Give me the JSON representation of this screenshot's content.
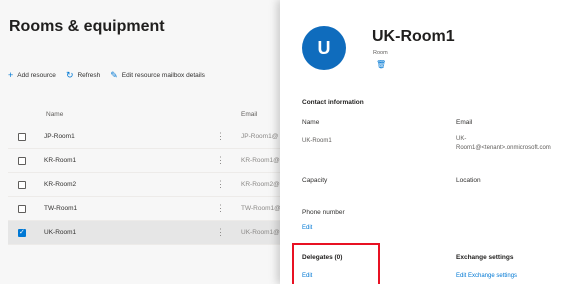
{
  "page": {
    "title": "Rooms & equipment"
  },
  "toolbar": {
    "add": "Add resource",
    "refresh": "Refresh",
    "edit_mailbox": "Edit resource mailbox details"
  },
  "list": {
    "columns": {
      "name": "Name",
      "email": "Email"
    },
    "rows": [
      {
        "name": "JP-Room1",
        "email": "JP-Room1@",
        "selected": false
      },
      {
        "name": "KR-Room1",
        "email": "KR-Room1@",
        "selected": false
      },
      {
        "name": "KR-Room2",
        "email": "KR-Room2@",
        "selected": false
      },
      {
        "name": "TW-Room1",
        "email": "TW-Room1@",
        "selected": false
      },
      {
        "name": "UK-Room1",
        "email": "UK-Room1@",
        "selected": true
      }
    ]
  },
  "panel": {
    "avatar_letter": "U",
    "title": "UK-Room1",
    "subtitle": "Room",
    "contact_section": "Contact information",
    "name_label": "Name",
    "name_value": "UK-Room1",
    "email_label": "Email",
    "email_value_line1": "UK-",
    "email_value_line2": "Room1@<tenant>.onmicrosoft.com",
    "capacity_label": "Capacity",
    "location_label": "Location",
    "phone_label": "Phone number",
    "phone_edit": "Edit",
    "delegates_label": "Delegates (0)",
    "delegates_edit": "Edit",
    "exchange_label": "Exchange settings",
    "exchange_edit": "Edit Exchange settings"
  },
  "colors": {
    "accent": "#0078d4",
    "avatar": "#0f6cbd",
    "highlight": "#e81123"
  }
}
